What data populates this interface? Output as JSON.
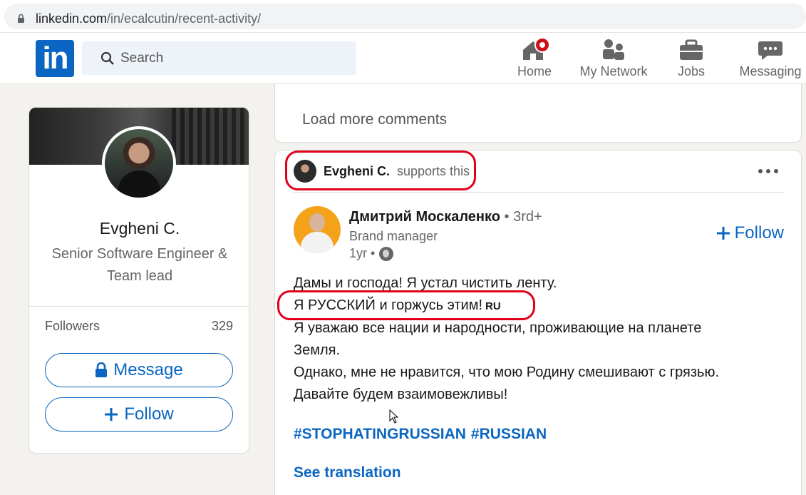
{
  "browser": {
    "url_host": "linkedin.com",
    "url_path": "/in/ecalcutin/recent-activity/"
  },
  "nav": {
    "logo": "in",
    "search_placeholder": "Search",
    "items": [
      {
        "label": "Home",
        "icon": "home-icon"
      },
      {
        "label": "My Network",
        "icon": "network-icon"
      },
      {
        "label": "Jobs",
        "icon": "briefcase-icon"
      },
      {
        "label": "Messaging",
        "icon": "messaging-icon"
      }
    ]
  },
  "profile": {
    "name": "Evgheni C.",
    "title": "Senior Software Engineer & Team lead",
    "followers_label": "Followers",
    "followers_count": "329",
    "message_button": "Message",
    "follow_button": "Follow"
  },
  "comments": {
    "load_more": "Load more comments"
  },
  "post": {
    "supporter_name": "Evgheni C.",
    "supporter_action": "supports this",
    "author_name": "Дмитрий Москаленко",
    "author_degree": "• 3rd+",
    "author_role": "Brand manager",
    "time": "1yr •",
    "follow_label": "Follow",
    "lines": [
      "Дамы и господа! Я устал чистить ленту.",
      "Я РУССКИЙ и горжусь этим!",
      "Я уважаю все нации и народности, проживающие на планете",
      "Земля.",
      "Однако, мне не нравится, что мою Родину смешивают с грязью.",
      "Давайте будем взаимовежливы!"
    ],
    "flag_text": "RU",
    "hashtags": [
      "#STOPHATINGRUSSIAN",
      "#RUSSIAN"
    ],
    "see_translation": "See translation"
  },
  "colors": {
    "linkedin_blue": "#0a66c2",
    "annotation_red": "#e0001b",
    "notification_red": "#cc1016"
  }
}
